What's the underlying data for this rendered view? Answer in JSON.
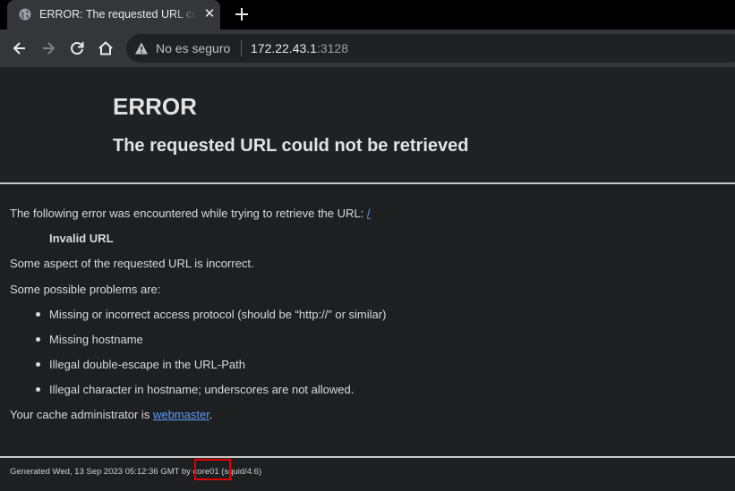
{
  "browser": {
    "tab": {
      "title": "ERROR: The requested URL could not be retrieved",
      "favicon": "globe-icon",
      "close_icon": "close-icon"
    },
    "new_tab_icon": "plus-icon",
    "toolbar": {
      "back_icon": "back-arrow-icon",
      "forward_icon": "forward-arrow-icon",
      "reload_icon": "reload-icon",
      "home_icon": "home-icon"
    },
    "omnibox": {
      "security_icon": "warning-icon",
      "security_label": "No es seguro",
      "host": "172.22.43.1",
      "port": ":3128"
    }
  },
  "page": {
    "title": "ERROR",
    "subtitle": "The requested URL could not be retrieved",
    "intro": "The following error was encountered while trying to retrieve the URL:",
    "url_link": "/",
    "error_name": "Invalid URL",
    "description": "Some aspect of the requested URL is incorrect.",
    "problems_heading": "Some possible problems are:",
    "problems": [
      "Missing or incorrect access protocol (should be “http://” or similar)",
      "Missing hostname",
      "Illegal double-escape in the URL-Path",
      "Illegal character in hostname; underscores are not allowed."
    ],
    "admin_prefix": "Your cache administrator is",
    "admin_link": "webmaster",
    "admin_suffix": ".",
    "footer": "Generated Wed, 13 Sep 2023 05:12:36 GMT by core01 (squid/4.6)"
  },
  "colors": {
    "tab_strip": "#000000",
    "toolbar": "#35363a",
    "page_bg": "#1e1f21",
    "link": "#5b9dfc",
    "highlight": "#e00000"
  }
}
